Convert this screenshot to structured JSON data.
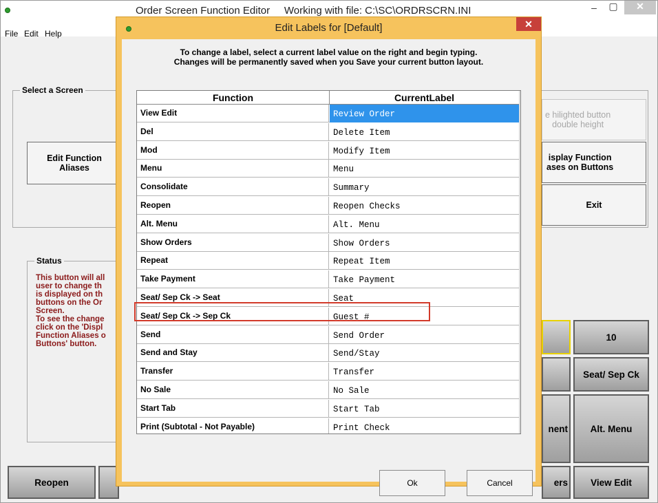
{
  "main_window": {
    "title": "Order Screen Function Editor     Working with file: C:\\SC\\ORDRSCRN.INI",
    "controls": {
      "minimize": "–",
      "maximize": "▢",
      "close": "✕"
    }
  },
  "menu": {
    "file": "File",
    "edit": "Edit",
    "help": "Help"
  },
  "screen_group": {
    "label": "Select a Screen",
    "edit_aliases": "Edit Function\nAliases",
    "double_height": "e hilighted button\ndouble height",
    "display_aliases": "isplay Function\nases on Buttons",
    "exit": "Exit"
  },
  "status_group": {
    "label": "Status",
    "text": "This button will all\nuser to change th\nis displayed on th\nbuttons on the Or\nScreen.\nTo see the change\nclick on the 'Displ\nFunction Aliases o\nButtons' button."
  },
  "right_buttons": {
    "ten": "10",
    "seat_sep": "Seat/ Sep Ck",
    "ment": "nent",
    "alt_menu": "Alt. Menu",
    "ers": "ers",
    "view_edit": "View Edit"
  },
  "bottom_buttons": {
    "reopen": "Reopen"
  },
  "dialog": {
    "title": "Edit Labels for [Default]",
    "close": "✕",
    "instructions": "To change a label, select a current label value on the right and begin typing.\nChanges will be permanently saved when you Save your current button layout.",
    "columns": {
      "function": "Function",
      "label": "CurrentLabel"
    },
    "rows": [
      {
        "function": "View Edit",
        "label": "Review Order"
      },
      {
        "function": "Del",
        "label": "Delete Item"
      },
      {
        "function": "Mod",
        "label": "Modify Item"
      },
      {
        "function": "Menu",
        "label": "Menu"
      },
      {
        "function": "Consolidate",
        "label": "Summary"
      },
      {
        "function": "Reopen",
        "label": "Reopen Checks"
      },
      {
        "function": "Alt. Menu",
        "label": "Alt. Menu"
      },
      {
        "function": "Show Orders",
        "label": "Show Orders"
      },
      {
        "function": "Repeat",
        "label": "Repeat Item"
      },
      {
        "function": "Take Payment",
        "label": "Take Payment"
      },
      {
        "function": "Seat/ Sep Ck -> Seat",
        "label": "Seat"
      },
      {
        "function": "Seat/ Sep Ck -> Sep Ck",
        "label": "Guest #"
      },
      {
        "function": "Send",
        "label": "Send Order"
      },
      {
        "function": "Send and Stay",
        "label": "Send/Stay"
      },
      {
        "function": "Transfer",
        "label": "Transfer"
      },
      {
        "function": "No Sale",
        "label": "No Sale"
      },
      {
        "function": "Start Tab",
        "label": "Start Tab"
      },
      {
        "function": "Print (Subtotal - Not Payable)",
        "label": "Print Check"
      }
    ],
    "selected_row": 0,
    "ok": "Ok",
    "cancel": "Cancel"
  },
  "colors": {
    "dialog_frame": "#f6c35d",
    "selection": "#2f93eb",
    "status_text": "#8b1a1a",
    "highlight": "#d23a2a"
  }
}
